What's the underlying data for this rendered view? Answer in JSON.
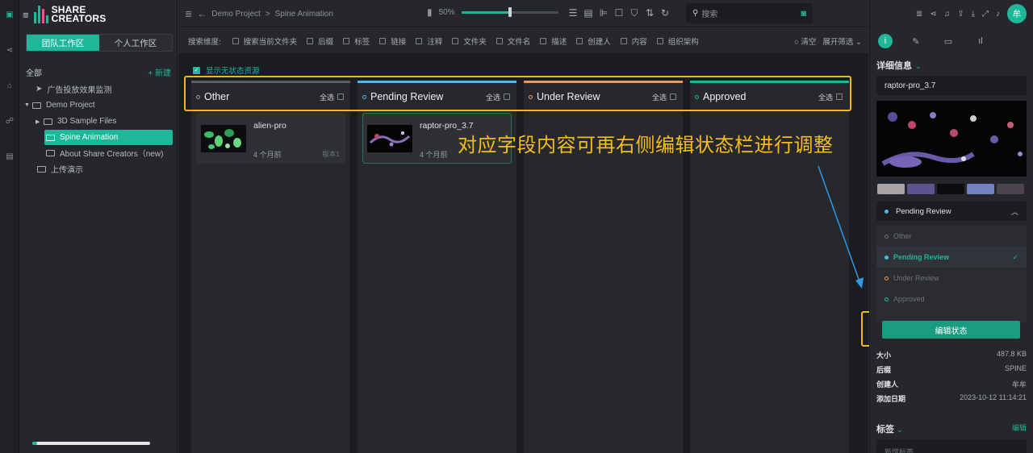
{
  "app": {
    "logo_line1": "SHARE",
    "logo_line2": "CREATORS"
  },
  "workspace_tabs": [
    "团队工作区",
    "个人工作区"
  ],
  "tree": {
    "root_label": "全部",
    "new_label": "+ 新建",
    "items": [
      {
        "label": "广告投放效果监测"
      },
      {
        "label": "Demo Project"
      },
      {
        "label": "3D Sample Files"
      },
      {
        "label": "Spine Animation"
      },
      {
        "label": "About Share Creators（new)"
      },
      {
        "label": "上传演示"
      }
    ]
  },
  "breadcrumb": {
    "project": "Demo Project",
    "separator": ">",
    "current": "Spine Animation"
  },
  "zoom": {
    "label": "50%",
    "value": 0.5
  },
  "search": {
    "placeholder": "搜索"
  },
  "filter": {
    "label": "搜索维度:",
    "options": [
      "搜索当前文件夹",
      "后缀",
      "标签",
      "链接",
      "注释",
      "文件夹",
      "文件名",
      "描述",
      "创建人",
      "内容",
      "组织架构"
    ],
    "clear": "清空",
    "expand": "展开筛选"
  },
  "board": {
    "show_no_status": "显示无状态资源",
    "select_all": "全选",
    "columns": [
      {
        "name": "Other",
        "color": "#5a5d65",
        "cards": [
          {
            "title": "alien-pro",
            "time": "4 个月前",
            "version": "版本1"
          }
        ]
      },
      {
        "name": "Pending Review",
        "color": "#4fb8e6",
        "cards": [
          {
            "title": "raptor-pro_3.7",
            "time": "4 个月前",
            "version": ""
          }
        ]
      },
      {
        "name": "Under Review",
        "color": "#e89a5a",
        "cards": []
      },
      {
        "name": "Approved",
        "color": "#1fb79a",
        "cards": []
      }
    ]
  },
  "annotation": {
    "text": "对应字段内容可再右侧编辑状态栏进行调整",
    "color": "#f0b718"
  },
  "details": {
    "avatar": "牟",
    "section_title": "详细信息",
    "file_name": "raptor-pro_3.7",
    "swatches": [
      "#a8a4a6",
      "#5b548e",
      "#0d0d0f",
      "#7182bd",
      "#4c4550"
    ],
    "current_status": "Pending Review",
    "status_options": [
      {
        "label": "Other",
        "selected": false
      },
      {
        "label": "Pending Review",
        "selected": true
      },
      {
        "label": "Under Review",
        "selected": false
      },
      {
        "label": "Approved",
        "selected": false
      }
    ],
    "edit_button": "编辑状态",
    "meta": [
      {
        "key": "大小",
        "value": "487.8 KB"
      },
      {
        "key": "后缀",
        "value": "SPINE"
      },
      {
        "key": "创建人",
        "value": "牟牟"
      },
      {
        "key": "添加日期",
        "value": "2023-10-12 11:14:21"
      }
    ],
    "tags_title": "标签",
    "tags_edit": "编辑",
    "tags_placeholder": "新增标签"
  },
  "storage_used_fraction": 0.04
}
